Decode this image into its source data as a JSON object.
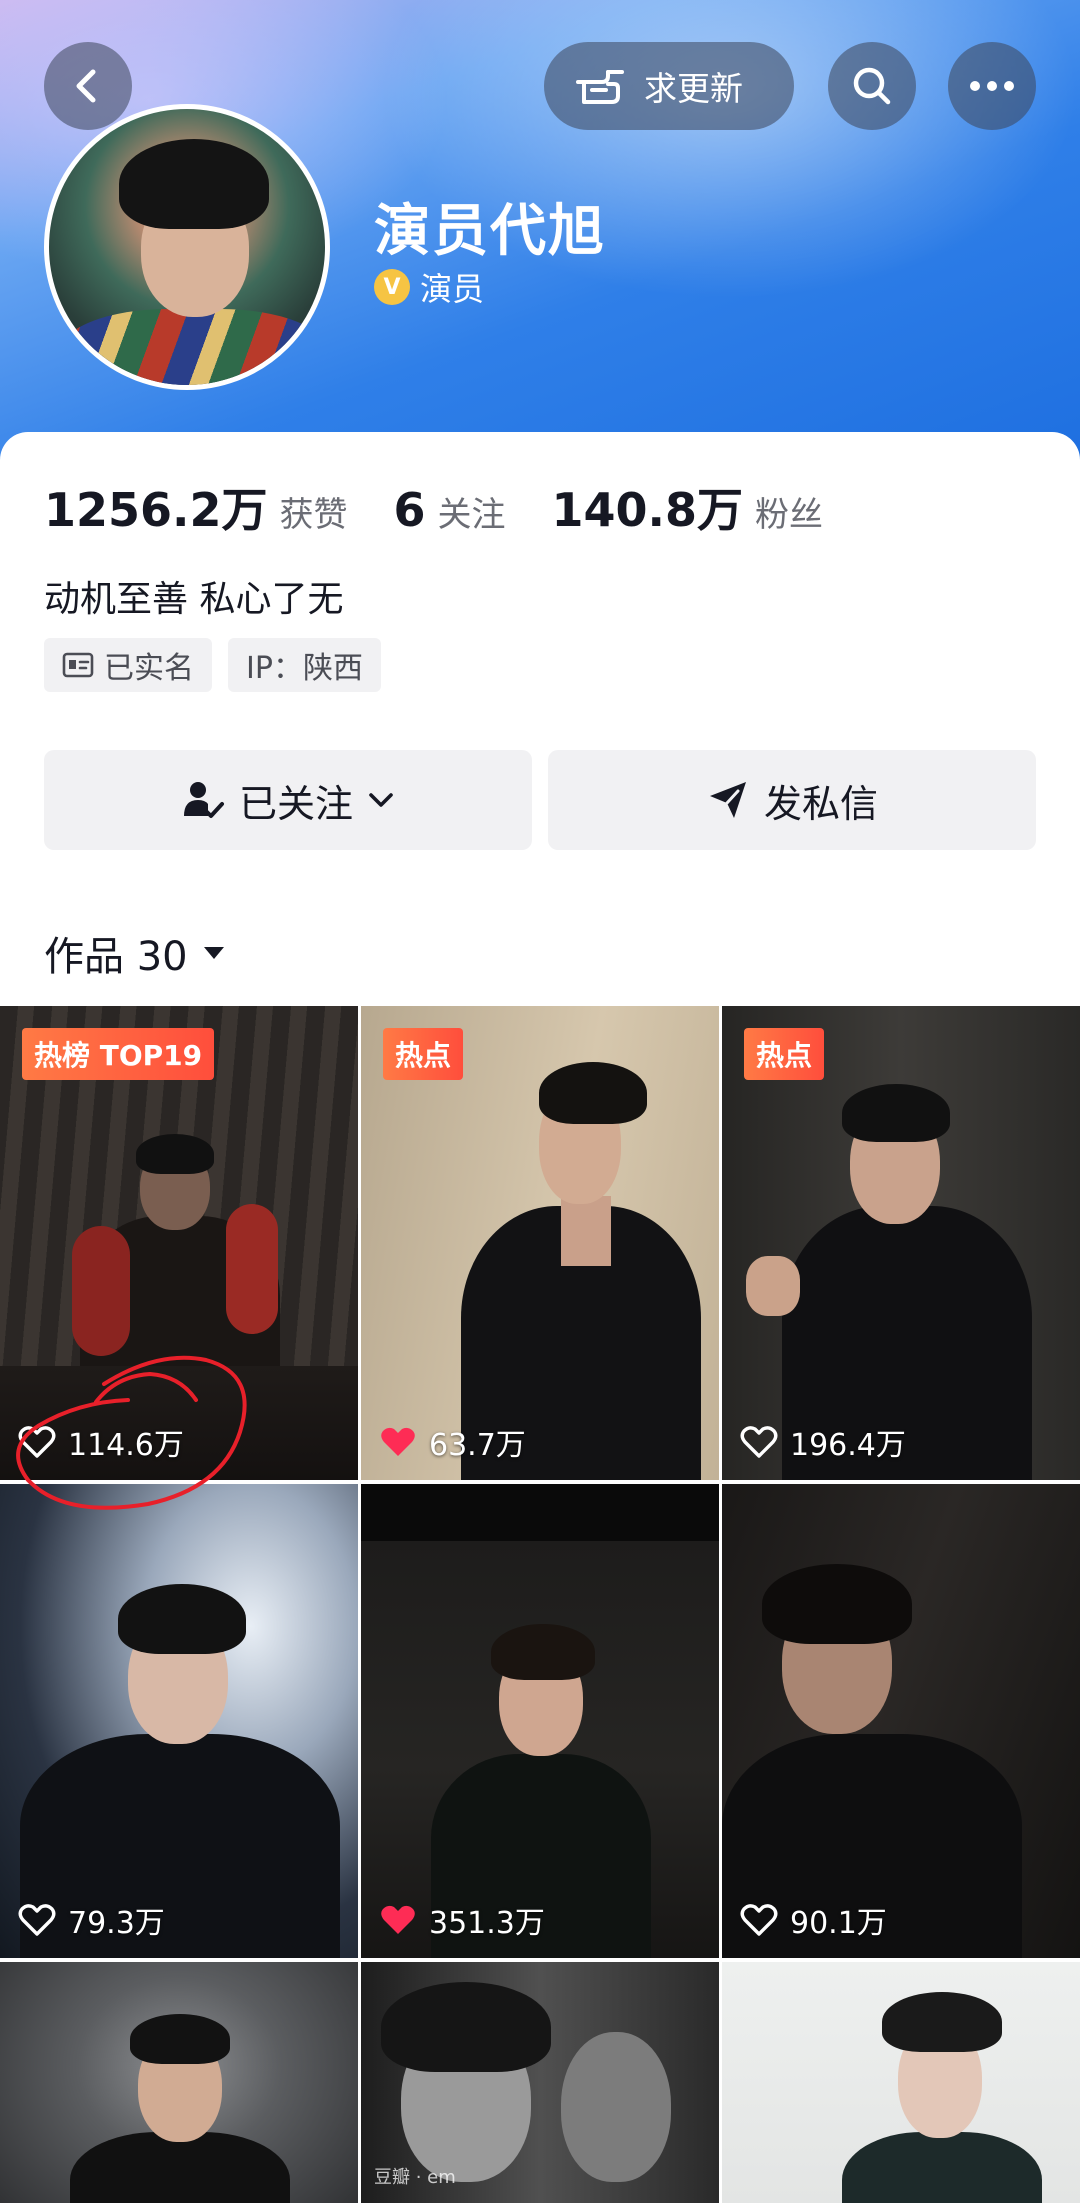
{
  "header": {
    "update_label": "求更新",
    "icons": [
      "back-arrow-icon",
      "pointing-hand-icon",
      "search-icon",
      "more-dots-icon"
    ]
  },
  "profile": {
    "name": "演员代旭",
    "verified_title": "演员",
    "verified_badge": "V"
  },
  "stats": {
    "likes_count": "1256.2万",
    "likes_label": "获赞",
    "following_count": "6",
    "following_label": "关注",
    "followers_count": "140.8万",
    "followers_label": "粉丝"
  },
  "bio": "动机至善 私心了无",
  "tags": {
    "realname": "已实名",
    "ip": "IP：陕西"
  },
  "actions": {
    "follow": "已关注",
    "message": "发私信"
  },
  "works_tab": {
    "label": "作品 30"
  },
  "videos": [
    {
      "badge": "热榜 TOP19",
      "likes": "114.6万",
      "liked": false
    },
    {
      "badge": "热点",
      "likes": "63.7万",
      "liked": true
    },
    {
      "badge": "热点",
      "likes": "196.4万",
      "liked": false
    },
    {
      "badge": "",
      "likes": "79.3万",
      "liked": false
    },
    {
      "badge": "",
      "likes": "351.3万",
      "liked": true
    },
    {
      "badge": "",
      "likes": "90.1万",
      "liked": false
    },
    {
      "badge": "",
      "likes": "",
      "liked": false
    },
    {
      "badge": "",
      "likes": "",
      "liked": false
    },
    {
      "badge": "",
      "likes": "",
      "liked": false
    }
  ],
  "colors": {
    "liked_heart": "#fe2c55",
    "badge": "#ff5a3c",
    "annotation_circle": "#e8202a"
  }
}
